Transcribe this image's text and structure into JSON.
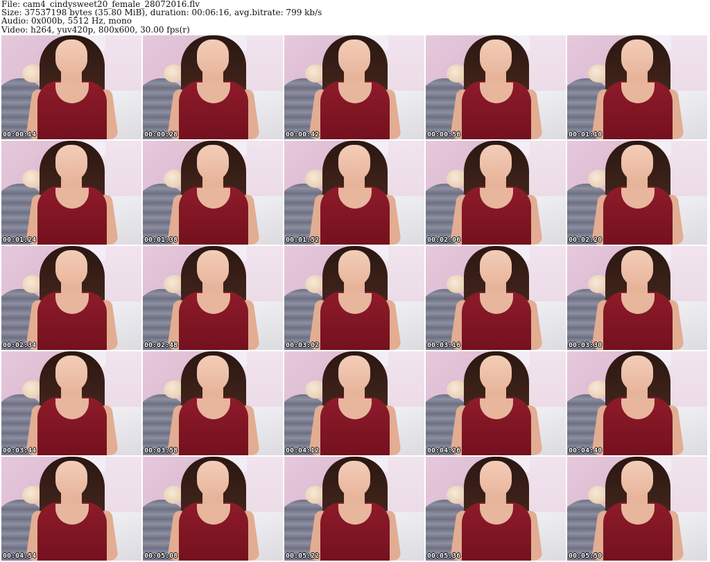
{
  "header": {
    "file": "File: cam4_cindysweet20_female_28072016.flv",
    "size": "Size: 37537198 bytes (35.80 MiB), duration: 00:06:16, avg.bitrate: 799 kb/s",
    "audio": "Audio: 0x000b, 5512 Hz, mono",
    "video": "Video: h264, yuv420p, 800x600, 30.00 fps(r)"
  },
  "thumbnails": [
    "00:00:14",
    "00:00:28",
    "00:00:42",
    "00:00:56",
    "00:01:10",
    "00:01:24",
    "00:01:38",
    "00:01:52",
    "00:02:06",
    "00:02:20",
    "00:02:34",
    "00:02:48",
    "00:03:02",
    "00:03:16",
    "00:03:30",
    "00:03:44",
    "00:03:58",
    "00:04:12",
    "00:04:26",
    "00:04:40",
    "00:04:54",
    "00:05:08",
    "00:05:22",
    "00:05:36",
    "00:05:50"
  ]
}
